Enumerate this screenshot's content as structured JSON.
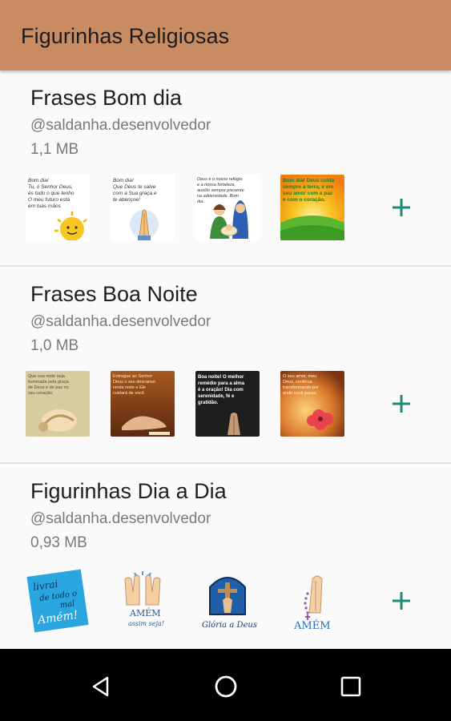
{
  "app_bar": {
    "title": "Figurinhas Religiosas"
  },
  "packs": [
    {
      "name": "Frases Bom dia",
      "publisher": "@saldanha.desenvolvedor",
      "size": "1,1 MB",
      "stickers": [
        {
          "icon": "morning-sun-sticker",
          "text": "Bom dia! Tu, ó Senhor Deus, és tudo o que tenho. O meu futuro está em tuas mãos."
        },
        {
          "icon": "praying-hands-sticker",
          "text": "Bom dia! Que Deus te salve com a Sua graça e te abençoe!"
        },
        {
          "icon": "holy-family-sticker",
          "text": "Deus é o nosso refúgio e a nossa fortaleza, auxílio sempre presente na adversidade. Bom dia."
        },
        {
          "icon": "sunrise-field-sticker",
          "text": "Bom dia! Deus cuida sempre a terra, e em seu amor com a paz e com o coração."
        }
      ]
    },
    {
      "name": "Frases Boa Noite",
      "publisher": "@saldanha.desenvolvedor",
      "size": "1,0 MB",
      "stickers": [
        {
          "icon": "night-hands-sticker",
          "text": "Que sua noite seja iluminada pela graça de Deus."
        },
        {
          "icon": "open-hand-sticker",
          "text": "Entregue ao Senhor Deus o seu descanso nesta noite."
        },
        {
          "icon": "night-prayer-sticker",
          "text": "Boa noite! O melhor remédio para a alma é a oração! Dia com serenidade, fé e gratidão."
        },
        {
          "icon": "flower-sunset-sticker",
          "text": "O seu amor, meu Deus, continua transformando por onde."
        }
      ]
    },
    {
      "name": "Figurinhas Dia a Dia",
      "publisher": "@saldanha.desenvolvedor",
      "size": "0,93 MB",
      "stickers": [
        {
          "icon": "livrai-nos-sticker",
          "text": "livrai-nos de todo o mal Amém!"
        },
        {
          "icon": "amem-hands-sticker",
          "text": "AMÉM assim seja!"
        },
        {
          "icon": "gloria-cross-sticker",
          "text": "Glória a Deus"
        },
        {
          "icon": "amem-rosary-sticker",
          "text": "AMÉM"
        }
      ]
    }
  ],
  "colors": {
    "app_bar": "#c98b62",
    "accent": "#1e8a73",
    "nav_bar": "#000000"
  },
  "nav": {
    "back": "back-icon",
    "home": "home-icon",
    "recent": "recents-icon"
  }
}
